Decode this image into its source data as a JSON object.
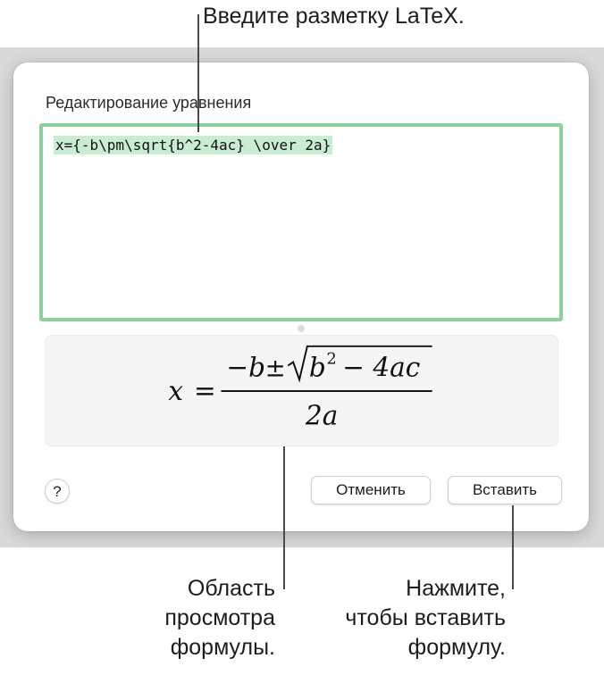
{
  "callouts": {
    "top": "Введите разметку LaTeX.",
    "preview_area": [
      "Область",
      "просмотра",
      "формулы."
    ],
    "insert_hint": [
      "Нажмите,",
      "чтобы вставить",
      "формулу."
    ]
  },
  "dialog": {
    "edit_label": "Редактирование уравнения",
    "latex_input": "x={-b\\pm\\sqrt{b^2-4ac} \\over 2a}",
    "help_label": "?",
    "cancel_label": "Отменить",
    "insert_label": "Вставить"
  },
  "formula_render": {
    "lhs": "x",
    "equals": "=",
    "numerator_minus_b": "−b",
    "plus_minus": "±",
    "radicand_base": "b",
    "radicand_exp": "2",
    "radicand_rest": "− 4ac",
    "denominator": "2a"
  },
  "colors": {
    "editor_border": "#8fcf9f",
    "selection_highlight": "#c9ecd2",
    "backdrop": "#d9d9d9"
  }
}
